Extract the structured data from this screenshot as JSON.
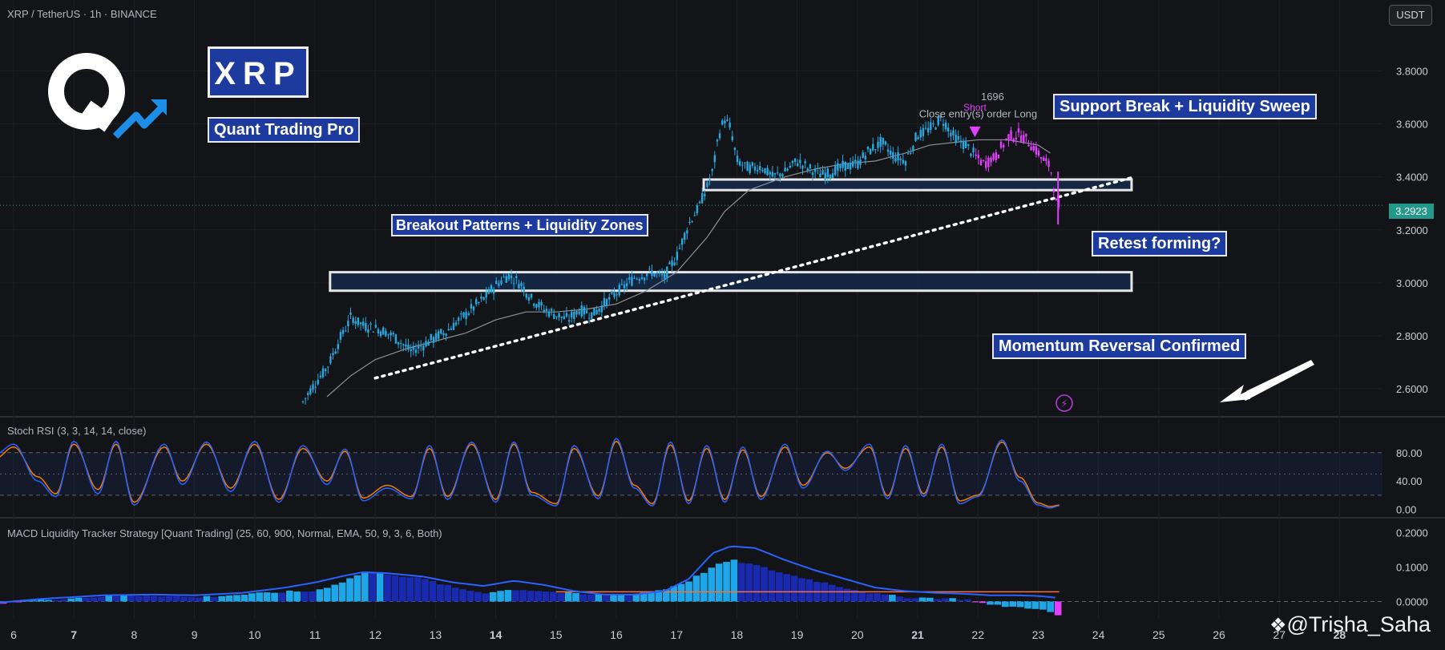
{
  "header": {
    "symbol_line": "XRP / TetherUS · 1h · BINANCE",
    "currency_button": "USDT"
  },
  "branding": {
    "logo_icon": "q-logo-with-arrow-icon",
    "ticker_label": "XRP",
    "brand_label": "Quant Trading Pro",
    "watermark": "@Trisha_Saha",
    "watermark_icon": "tradingview-diamond-icon"
  },
  "annotations": {
    "breakout": "Breakout Patterns + Liquidity Zones",
    "support_break": "Support Break + Liquidity Sweep",
    "retest": "Retest forming?",
    "momentum": "Momentum Reversal Confirmed",
    "trade_id": "1696",
    "short_label": "Short",
    "close_entry": "Close entry(s) order Long",
    "alert_icon": "lightning-alert-icon"
  },
  "colors": {
    "background": "#131417",
    "bull_candle": "#26a9e0",
    "short_candle": "#e040fb",
    "zone_fill": "#16294a",
    "annotation_fill": "#1d3a9e",
    "price_tag": "#22998a",
    "k_line": "#2962ff",
    "d_line": "#f57c00",
    "macd_line": "#2962ff",
    "signal_line": "#ff6d3a",
    "hist_pos_light": "#1ea7e8",
    "hist_pos_dark": "#1a2ab0",
    "hist_neg": "#e040fb"
  },
  "chart_data": [
    {
      "type": "candlestick",
      "x": [
        "6",
        "7",
        "8",
        "9",
        "10",
        "11",
        "12",
        "13",
        "14",
        "15",
        "16",
        "17",
        "18",
        "19",
        "20",
        "21",
        "22",
        "23",
        "24",
        "25",
        "26",
        "27",
        "28"
      ],
      "x_bold": [
        "7",
        "14",
        "21",
        "28"
      ],
      "close_path_x": [
        10.8,
        11.0,
        11.2,
        11.4,
        11.6,
        11.8,
        12.0,
        12.3,
        12.6,
        12.9,
        13.2,
        13.5,
        13.8,
        14.0,
        14.2,
        14.4,
        14.6,
        14.8,
        15.0,
        15.2,
        15.4,
        15.6,
        15.8,
        16.0,
        16.3,
        16.6,
        16.8,
        17.0,
        17.2,
        17.4,
        17.5,
        17.6,
        17.7,
        17.8,
        17.9,
        18.0,
        18.2,
        18.4,
        18.6,
        18.8,
        19.0,
        19.2,
        19.4,
        19.6,
        19.8,
        20.0,
        20.2,
        20.4,
        20.6,
        20.8,
        21.0,
        21.2,
        21.4,
        21.6,
        21.8,
        21.95,
        22.1,
        22.3,
        22.5,
        22.7,
        22.9,
        23.0,
        23.1,
        23.2,
        23.25,
        23.3,
        23.35
      ],
      "close_path_y": [
        2.55,
        2.62,
        2.68,
        2.78,
        2.87,
        2.84,
        2.83,
        2.8,
        2.74,
        2.78,
        2.82,
        2.88,
        2.94,
        2.99,
        3.03,
        3.0,
        2.94,
        2.9,
        2.88,
        2.86,
        2.9,
        2.88,
        2.92,
        2.96,
        3.02,
        3.04,
        3.02,
        3.1,
        3.22,
        3.3,
        3.36,
        3.42,
        3.56,
        3.62,
        3.58,
        3.46,
        3.43,
        3.44,
        3.4,
        3.42,
        3.46,
        3.43,
        3.41,
        3.42,
        3.44,
        3.45,
        3.5,
        3.53,
        3.48,
        3.46,
        3.56,
        3.58,
        3.62,
        3.55,
        3.52,
        3.48,
        3.45,
        3.48,
        3.55,
        3.56,
        3.52,
        3.49,
        3.46,
        3.44,
        3.38,
        3.3,
        3.29
      ],
      "short_from_x": 21.95,
      "ma_x": [
        11.2,
        11.6,
        12.0,
        12.5,
        13.0,
        13.5,
        14.0,
        14.5,
        15.0,
        15.5,
        16.0,
        16.5,
        17.0,
        17.5,
        17.8,
        18.2,
        18.8,
        19.3,
        19.8,
        20.3,
        20.8,
        21.2,
        21.6,
        22.0,
        22.5,
        23.0,
        23.2
      ],
      "ma_y": [
        2.57,
        2.65,
        2.71,
        2.75,
        2.78,
        2.81,
        2.86,
        2.89,
        2.89,
        2.9,
        2.92,
        2.97,
        3.04,
        3.17,
        3.27,
        3.35,
        3.4,
        3.43,
        3.45,
        3.46,
        3.49,
        3.52,
        3.53,
        3.54,
        3.54,
        3.52,
        3.49
      ],
      "ylim": [
        2.5,
        3.95
      ],
      "y_ticks": [
        "2.6000",
        "2.8000",
        "3.0000",
        "3.2000",
        "3.4000",
        "3.6000",
        "3.8000"
      ],
      "y_tick_values": [
        2.6,
        2.8,
        3.0,
        3.2,
        3.4,
        3.6,
        3.8
      ],
      "last_price": "3.2923",
      "zones": [
        {
          "x0": 11.25,
          "x1": 24.55,
          "y0": 2.97,
          "y1": 3.04
        },
        {
          "x0": 17.45,
          "x1": 24.55,
          "y0": 3.35,
          "y1": 3.39
        }
      ],
      "trendline": {
        "x0": 12.0,
        "y0": 2.64,
        "x1": 24.6,
        "y1": 3.4
      }
    },
    {
      "type": "line",
      "title": "Stoch RSI (3, 3, 14, 14, close)",
      "y_ticks": [
        "80.00",
        "40.00",
        "0.00"
      ],
      "y_tick_values": [
        80,
        40,
        0
      ],
      "ylim": [
        -5,
        108
      ],
      "bands": [
        20,
        80
      ],
      "x": [
        5.7,
        6.0,
        6.4,
        6.7,
        7.0,
        7.4,
        7.7,
        8.0,
        8.5,
        8.8,
        9.2,
        9.6,
        10.0,
        10.4,
        10.8,
        11.2,
        11.5,
        11.8,
        12.2,
        12.6,
        12.9,
        13.2,
        13.6,
        14.0,
        14.3,
        14.6,
        15.0,
        15.3,
        15.7,
        16.0,
        16.3,
        16.6,
        16.9,
        17.2,
        17.5,
        17.8,
        18.1,
        18.4,
        18.8,
        19.1,
        19.5,
        19.8,
        20.2,
        20.5,
        20.8,
        21.1,
        21.4,
        21.7,
        22.0,
        22.4,
        22.7,
        23.0,
        23.2,
        23.35
      ],
      "k": [
        78,
        92,
        40,
        18,
        96,
        22,
        96,
        6,
        92,
        35,
        95,
        25,
        96,
        10,
        90,
        35,
        85,
        12,
        30,
        15,
        90,
        14,
        95,
        10,
        95,
        20,
        5,
        90,
        15,
        100,
        30,
        5,
        95,
        8,
        90,
        10,
        88,
        14,
        92,
        30,
        82,
        55,
        92,
        15,
        90,
        18,
        92,
        8,
        18,
        98,
        40,
        6,
        2,
        5
      ],
      "d": [
        72,
        88,
        46,
        22,
        92,
        28,
        92,
        10,
        88,
        40,
        92,
        30,
        92,
        14,
        86,
        40,
        82,
        16,
        34,
        18,
        86,
        18,
        92,
        14,
        92,
        24,
        8,
        86,
        19,
        96,
        34,
        8,
        91,
        12,
        86,
        14,
        84,
        18,
        88,
        34,
        80,
        58,
        88,
        19,
        86,
        22,
        88,
        12,
        20,
        95,
        45,
        9,
        4,
        6
      ]
    },
    {
      "type": "bar",
      "title": "MACD Liquidity Tracker Strategy [Quant Trading] (25, 60, 900, Normal, EMA, 50, 9, 3, 6, Both)",
      "y_ticks": [
        "0.2000",
        "0.1000",
        "0.0000"
      ],
      "y_tick_values": [
        0.2,
        0.1,
        0.0
      ],
      "ylim": [
        -0.05,
        0.21
      ],
      "x": [
        5.7,
        6.5,
        7.5,
        8.3,
        9.0,
        9.8,
        10.5,
        11.0,
        11.5,
        11.8,
        12.2,
        12.8,
        13.3,
        13.8,
        14.3,
        14.8,
        15.3,
        15.8,
        16.3,
        16.8,
        17.2,
        17.6,
        17.9,
        18.3,
        18.8,
        19.3,
        19.8,
        20.3,
        20.8,
        21.3,
        21.8,
        22.2,
        22.6,
        23.0,
        23.35
      ],
      "hist": [
        -0.005,
        0.005,
        0.015,
        0.018,
        0.012,
        0.02,
        0.028,
        0.03,
        0.06,
        0.085,
        0.08,
        0.065,
        0.04,
        0.025,
        0.035,
        0.03,
        0.022,
        0.018,
        0.022,
        0.035,
        0.06,
        0.1,
        0.12,
        0.105,
        0.08,
        0.06,
        0.04,
        0.022,
        0.012,
        0.01,
        0.006,
        -0.01,
        -0.016,
        -0.02,
        -0.042
      ],
      "macd": [
        -0.004,
        0.008,
        0.018,
        0.02,
        0.018,
        0.025,
        0.04,
        0.055,
        0.075,
        0.085,
        0.082,
        0.072,
        0.055,
        0.045,
        0.06,
        0.048,
        0.03,
        0.02,
        0.02,
        0.03,
        0.065,
        0.14,
        0.16,
        0.155,
        0.12,
        0.09,
        0.065,
        0.04,
        0.03,
        0.025,
        0.022,
        0.018,
        0.018,
        0.016,
        0.01
      ],
      "signal_y": 0.028,
      "signal_x": [
        15.0,
        23.35
      ]
    }
  ]
}
